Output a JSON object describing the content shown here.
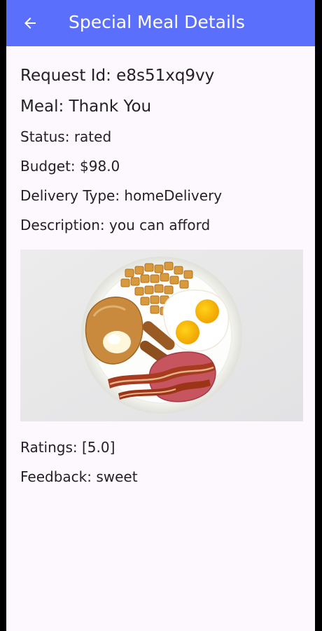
{
  "appbar": {
    "title": "Special Meal Details",
    "back_icon": "arrow-left-icon",
    "background": "#5b6ffd"
  },
  "details": {
    "request_id": "Request Id: e8s51xq9vy",
    "meal": "Meal: Thank You",
    "status": "Status: rated",
    "budget": "Budget: $98.0",
    "delivery_type": "Delivery Type: homeDelivery",
    "description": "Description: you can afford"
  },
  "image": {
    "subject": "breakfast-plate-photo"
  },
  "ratings": "Ratings: [5.0]",
  "feedback": "Feedback: sweet"
}
